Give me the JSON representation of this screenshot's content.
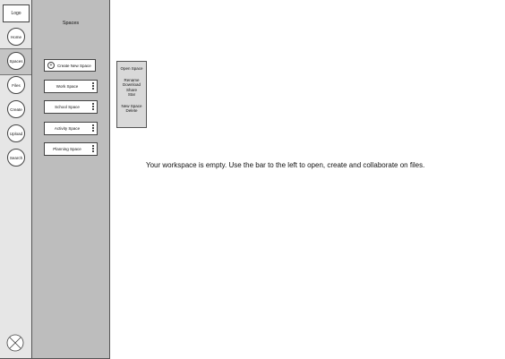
{
  "rail": {
    "logo": "Logo",
    "items": [
      {
        "label": "Home"
      },
      {
        "label": "Spaces"
      },
      {
        "label": "Files"
      },
      {
        "label": "Create"
      },
      {
        "label": "Upload"
      },
      {
        "label": "Search"
      }
    ]
  },
  "panel": {
    "title": "Spaces",
    "create_label": "Create New Space",
    "spaces": [
      {
        "label": "Work Space"
      },
      {
        "label": "School Space"
      },
      {
        "label": "Activity Space"
      },
      {
        "label": "Planning Space"
      }
    ]
  },
  "context_menu": {
    "items": [
      "Open Space",
      "Rename",
      "Download",
      "Share",
      "Star",
      "New Space",
      "Delete"
    ]
  },
  "main": {
    "empty_message": "Your workspace is empty. Use the bar to the left to open, create and collaborate on files."
  }
}
